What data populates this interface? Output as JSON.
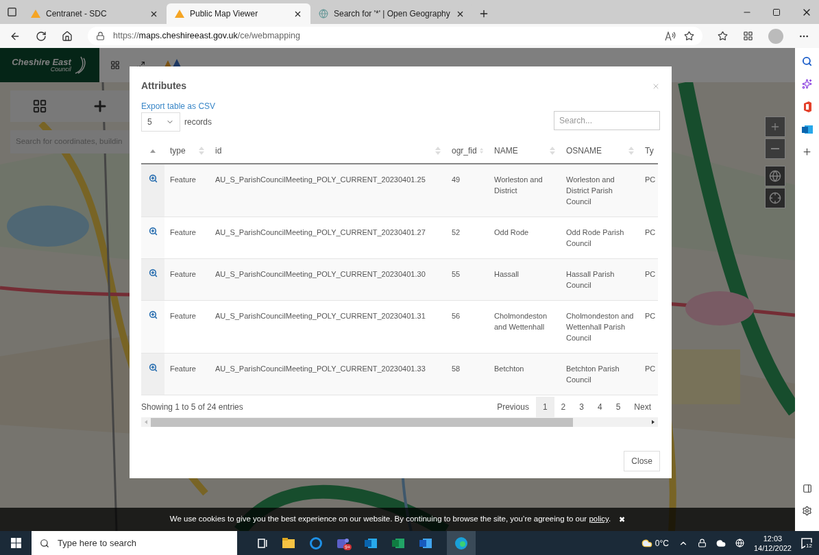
{
  "browser": {
    "tabs": [
      {
        "title": "Centranet - SDC",
        "selected": false,
        "kind": "triangle"
      },
      {
        "title": "Public Map Viewer",
        "selected": true,
        "kind": "triangle"
      },
      {
        "title": "Search for '*' | Open Geography",
        "selected": false,
        "kind": "globe"
      }
    ],
    "url": {
      "scheme": "https://",
      "host": "maps.cheshireeast.gov.uk",
      "path": "/ce/webmapping"
    }
  },
  "app": {
    "logo": {
      "name": "Cheshire East",
      "sub": "Council"
    },
    "search": {
      "placeholder": "Search for coordinates, buildin"
    }
  },
  "dialog": {
    "title": "Attributes",
    "export_link": "Export table as CSV",
    "page_size": "5",
    "page_size_label": "records",
    "search": {
      "placeholder": "Search..."
    },
    "icon_column": {
      "sorted": true
    },
    "columns": [
      {
        "label": "type",
        "sortable": true
      },
      {
        "label": "id",
        "sortable": true
      },
      {
        "label": "ogr_fid",
        "sortable": true
      },
      {
        "label": "NAME",
        "sortable": true
      },
      {
        "label": "OSNAME",
        "sortable": true
      },
      {
        "label": "Ty"
      }
    ],
    "rows": [
      {
        "cells": [
          "Feature",
          "AU_S_ParishCouncilMeeting_POLY_CURRENT_20230401.25",
          "49",
          "Worleston and District",
          "Worleston and District Parish Council",
          "PC"
        ]
      },
      {
        "cells": [
          "Feature",
          "AU_S_ParishCouncilMeeting_POLY_CURRENT_20230401.27",
          "52",
          "Odd Rode",
          "Odd Rode Parish Council",
          "PC"
        ]
      },
      {
        "cells": [
          "Feature",
          "AU_S_ParishCouncilMeeting_POLY_CURRENT_20230401.30",
          "55",
          "Hassall",
          "Hassall Parish Council",
          "PC"
        ]
      },
      {
        "cells": [
          "Feature",
          "AU_S_ParishCouncilMeeting_POLY_CURRENT_20230401.31",
          "56",
          "Cholmondeston and Wettenhall",
          "Cholmondeston and Wettenhall Parish Council",
          "PC"
        ]
      },
      {
        "cells": [
          "Feature",
          "AU_S_ParishCouncilMeeting_POLY_CURRENT_20230401.33",
          "58",
          "Betchton",
          "Betchton Parish Council",
          "PC"
        ]
      }
    ],
    "info": "Showing 1 to 5 of 24 entries",
    "pagination": [
      {
        "label": "Previous",
        "selected": false
      },
      {
        "label": "1",
        "selected": true
      },
      {
        "label": "2",
        "selected": false
      },
      {
        "label": "3",
        "selected": false
      },
      {
        "label": "4",
        "selected": false
      },
      {
        "label": "5",
        "selected": false
      },
      {
        "label": "Next",
        "selected": false
      }
    ],
    "close": "Close"
  },
  "cookie_bar": {
    "text": "We use cookies to give you the best experience on our website. By continuing to browse the site, you’re agreeing to our ",
    "link": "policy",
    "end": ".",
    "close": "✖"
  },
  "taskbar": {
    "search": {
      "placeholder": "Type here to search"
    },
    "teams_badge": "9+",
    "temperature": "0°C",
    "time": "12:03",
    "date": "14/12/2022",
    "notifications": "12"
  }
}
